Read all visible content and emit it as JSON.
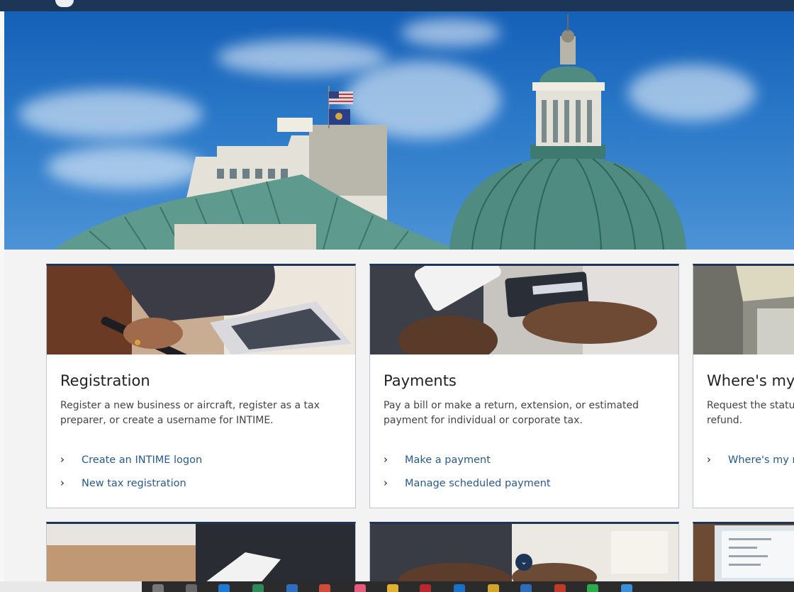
{
  "cards": [
    {
      "title": "Registration",
      "description": "Register a new business or aircraft, register as a tax preparer, or create a username for INTIME.",
      "links": [
        "Create an INTIME logon",
        "New tax registration"
      ]
    },
    {
      "title": "Payments",
      "description": "Pay a bill or make a return, extension, or estimated payment for individual or corporate tax.",
      "links": [
        "Make a payment",
        "Manage scheduled payment"
      ]
    },
    {
      "title": "Where's my",
      "description": "Request the statu refund.",
      "links": [
        "Where's my r"
      ]
    }
  ],
  "icons": {
    "scroll": "chevron-down-icon",
    "link_arrow": "chevron-right-icon"
  },
  "colors": {
    "nav": "#1d3557",
    "link": "#2a5a8a",
    "card_border": "#b8c4d2"
  }
}
